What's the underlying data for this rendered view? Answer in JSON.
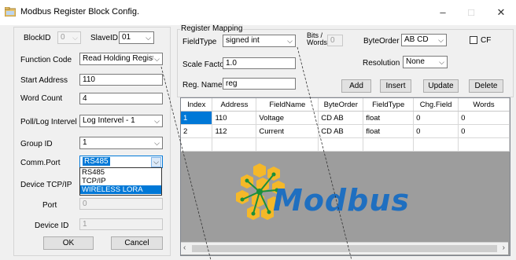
{
  "window": {
    "title": "Modbus Register Block Config.",
    "minimize": "–",
    "maximize": "□",
    "close": "✕"
  },
  "left": {
    "block_id_label": "BlockID",
    "block_id_value": "0",
    "slave_id_label": "SlaveID",
    "slave_id_value": "01",
    "function_code_label": "Function Code",
    "function_code_value": "Read Holding Registe",
    "start_address_label": "Start Address",
    "start_address_value": "110",
    "word_count_label": "Word Count",
    "word_count_value": "4",
    "poll_label": "Poll/Log Intervel",
    "poll_value": "Log Intervel - 1",
    "group_id_label": "Group ID",
    "group_id_value": "1",
    "comm_port_label": "Comm.Port",
    "comm_port_value": "RS485",
    "comm_port_options": [
      "RS485",
      "TCP/IP",
      "WIRELESS LORA"
    ],
    "device_tcp_label": "Device TCP/IP",
    "port_label": "Port",
    "port_value": "0",
    "device_id_label": "Device ID",
    "device_id_value": "1",
    "ok_label": "OK",
    "cancel_label": "Cancel"
  },
  "mapping": {
    "group_label": "Register Mapping",
    "field_type_label": "FieldType",
    "field_type_value": "signed int",
    "bits_words_label_1": "Bits /",
    "bits_words_label_2": "Words",
    "bits_words_value": "0",
    "byte_order_label": "ByteOrder",
    "byte_order_value": "AB CD",
    "cf_label": "CF",
    "scale_factor_label": "Scale Factor",
    "scale_factor_value": "1.0",
    "resolution_label": "Resolution",
    "resolution_value": "None",
    "reg_name_label": "Reg. Name",
    "reg_name_value": "reg",
    "add_label": "Add",
    "insert_label": "Insert",
    "update_label": "Update",
    "delete_label": "Delete"
  },
  "table": {
    "columns": [
      "Index",
      "Address",
      "FieldName",
      "ByteOrder",
      "FieldType",
      "Chg.Field",
      "Words"
    ],
    "rows": [
      [
        "1",
        "110",
        "Voltage",
        "CD AB",
        "float",
        "0",
        "0"
      ],
      [
        "2",
        "112",
        "Current",
        "CD AB",
        "float",
        "0",
        "0"
      ]
    ]
  },
  "logo": {
    "text": "Modbus"
  },
  "colors": {
    "accent": "#0078d7",
    "logo_text": "#1f6fc0",
    "logo_hex": "#f5b829",
    "panel_bg": "#9d9d9d"
  }
}
